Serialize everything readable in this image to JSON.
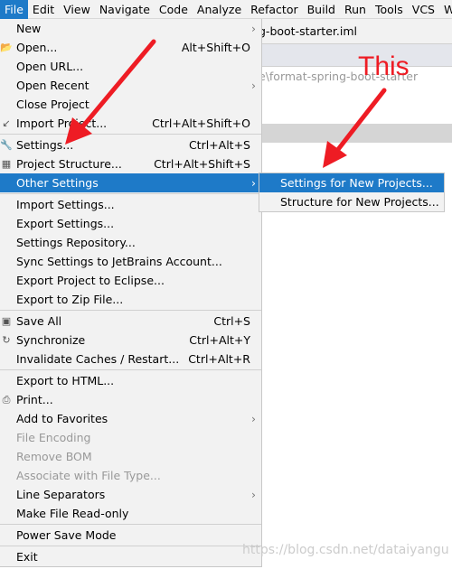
{
  "menubar": [
    "File",
    "Edit",
    "View",
    "Navigate",
    "Code",
    "Analyze",
    "Refactor",
    "Build",
    "Run",
    "Tools",
    "VCS",
    "Wi"
  ],
  "editor": {
    "tab": "g-boot-starter.iml",
    "path": "e\\format-spring-boot-starter"
  },
  "menu": [
    {
      "label": "New",
      "submenu": true
    },
    {
      "label": "Open...",
      "shortcut": "Alt+Shift+O",
      "icon": "folder-open-icon"
    },
    {
      "label": "Open URL..."
    },
    {
      "label": "Open Recent",
      "submenu": true
    },
    {
      "label": "Close Project"
    },
    {
      "label": "Import Project...",
      "shortcut": "Ctrl+Alt+Shift+O",
      "icon": "import-icon"
    },
    {
      "sep": true
    },
    {
      "label": "Settings...",
      "shortcut": "Ctrl+Alt+S",
      "icon": "wrench-icon"
    },
    {
      "label": "Project Structure...",
      "shortcut": "Ctrl+Alt+Shift+S",
      "icon": "project-structure-icon"
    },
    {
      "label": "Other Settings",
      "submenu": true,
      "selected": true
    },
    {
      "sep": true
    },
    {
      "label": "Import Settings..."
    },
    {
      "label": "Export Settings..."
    },
    {
      "label": "Settings Repository..."
    },
    {
      "label": "Sync Settings to JetBrains Account..."
    },
    {
      "label": "Export Project to Eclipse..."
    },
    {
      "label": "Export to Zip File..."
    },
    {
      "sep": true
    },
    {
      "label": "Save All",
      "shortcut": "Ctrl+S",
      "icon": "save-icon"
    },
    {
      "label": "Synchronize",
      "shortcut": "Ctrl+Alt+Y",
      "icon": "sync-icon"
    },
    {
      "label": "Invalidate Caches / Restart...",
      "shortcut": "Ctrl+Alt+R"
    },
    {
      "sep": true
    },
    {
      "label": "Export to HTML..."
    },
    {
      "label": "Print...",
      "icon": "printer-icon"
    },
    {
      "label": "Add to Favorites",
      "submenu": true
    },
    {
      "label": "File Encoding",
      "disabled": true
    },
    {
      "label": "Remove BOM",
      "disabled": true
    },
    {
      "label": "Associate with File Type...",
      "disabled": true
    },
    {
      "label": "Line Separators",
      "submenu": true
    },
    {
      "label": "Make File Read-only"
    },
    {
      "sep": true
    },
    {
      "label": "Power Save Mode"
    },
    {
      "sep": true
    },
    {
      "label": "Exit"
    }
  ],
  "submenu": [
    {
      "label": "Settings for New Projects...",
      "selected": true
    },
    {
      "label": "Structure for New Projects..."
    }
  ],
  "annotation": {
    "text": "This",
    "color": "#ee1c24"
  },
  "watermark": "https://blog.csdn.net/dataiyangu",
  "colors": {
    "accent": "#1e7ac8",
    "menu_bg": "#f2f2f2"
  }
}
